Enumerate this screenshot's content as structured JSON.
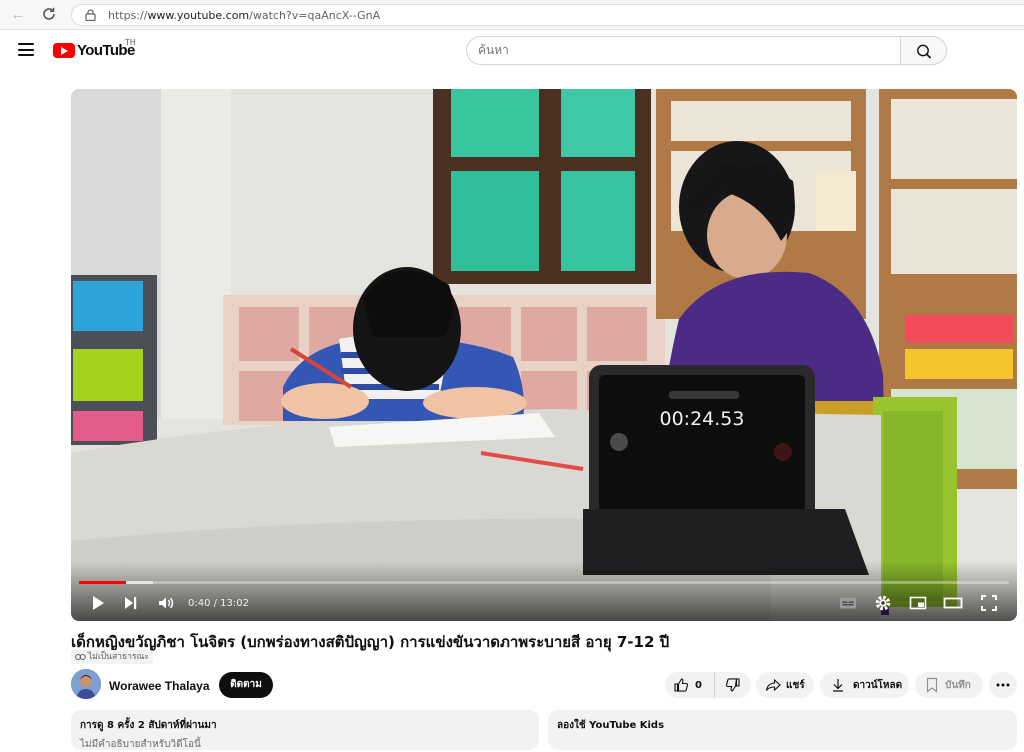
{
  "browser": {
    "url_prefix": "https://",
    "url_domain": "www.youtube.com",
    "url_path": "/watch?v=qaAncX--GnA"
  },
  "header": {
    "logo_text": "YouTube",
    "logo_country": "TH",
    "search_placeholder": "ค้นหา"
  },
  "player": {
    "time_current": "0:40",
    "time_total": "13:02",
    "time_label": "0:40 / 13:02",
    "progress_fraction": 0.051,
    "stopwatch": "00:24.53"
  },
  "video": {
    "title": "เด็กหญิงขวัญภิชา โนจิตร (บกพร่องทางสติปัญญา) การแข่งขันวาดภาพระบายสี อายุ 7-12 ปี",
    "visibility": "ไม่เป็นสาธารณะ"
  },
  "channel": {
    "name": "Worawee Thalaya",
    "subscribe_label": "ติดตาม"
  },
  "actions": {
    "like_count": "0",
    "share_label": "แชร์",
    "download_label": "ดาวน์โหลด",
    "save_label": "บันทึก"
  },
  "description": {
    "stats": "การดู 8 ครั้ง  2 สัปดาห์ที่ผ่านมา",
    "note": "ไม่มีคำอธิบายสำหรับวิดีโอนี้"
  },
  "kids_promo": {
    "label": "ลองใช้ YouTube Kids"
  }
}
